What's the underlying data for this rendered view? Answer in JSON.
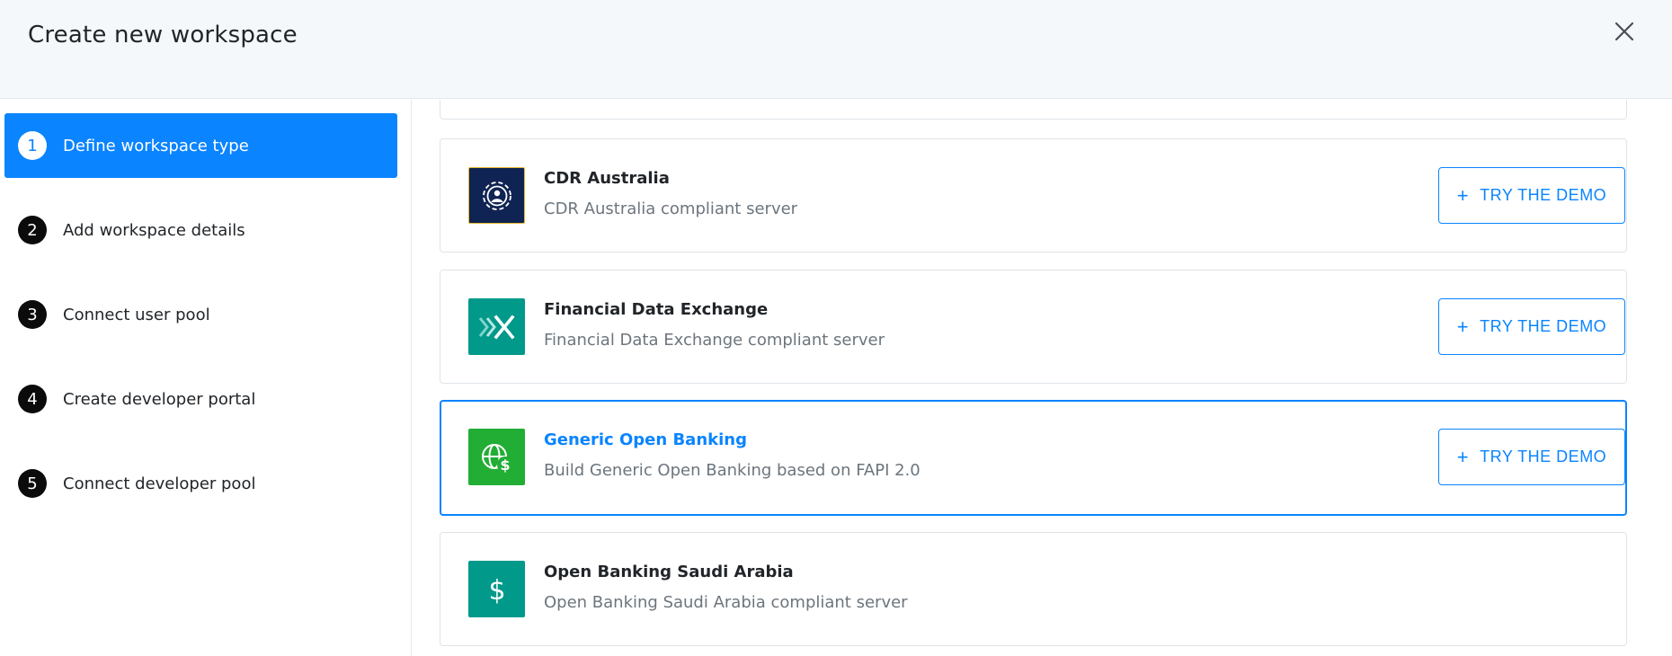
{
  "dialog": {
    "title": "Create new workspace"
  },
  "steps": [
    {
      "number": "1",
      "label": "Define workspace type",
      "active": true
    },
    {
      "number": "2",
      "label": "Add workspace details",
      "active": false
    },
    {
      "number": "3",
      "label": "Connect user pool",
      "active": false
    },
    {
      "number": "4",
      "label": "Create developer portal",
      "active": false
    },
    {
      "number": "5",
      "label": "Connect developer pool",
      "active": false
    }
  ],
  "workspace_types": [
    {
      "title": "CDR Australia",
      "description": "CDR Australia compliant server",
      "icon": "cdr-australia-logo-icon",
      "color": "#0f2453",
      "button": "TRY THE DEMO",
      "selected": false
    },
    {
      "title": "Financial Data Exchange",
      "description": "Financial Data Exchange compliant server",
      "icon": "fdx-logo-icon",
      "color": "#00998a",
      "button": "TRY THE DEMO",
      "selected": false
    },
    {
      "title": "Generic Open Banking",
      "description": "Build Generic Open Banking based on FAPI 2.0",
      "icon": "globe-dollar-icon",
      "color": "#22ad35",
      "button": "TRY THE DEMO",
      "selected": true
    },
    {
      "title": "Open Banking Saudi Arabia",
      "description": "Open Banking Saudi Arabia compliant server",
      "icon": "dollar-icon",
      "color": "#00998a",
      "selected": false
    }
  ],
  "colors": {
    "accent": "#0a84ff",
    "header_bg": "#f4f8fb",
    "muted_text": "#6c757d"
  }
}
